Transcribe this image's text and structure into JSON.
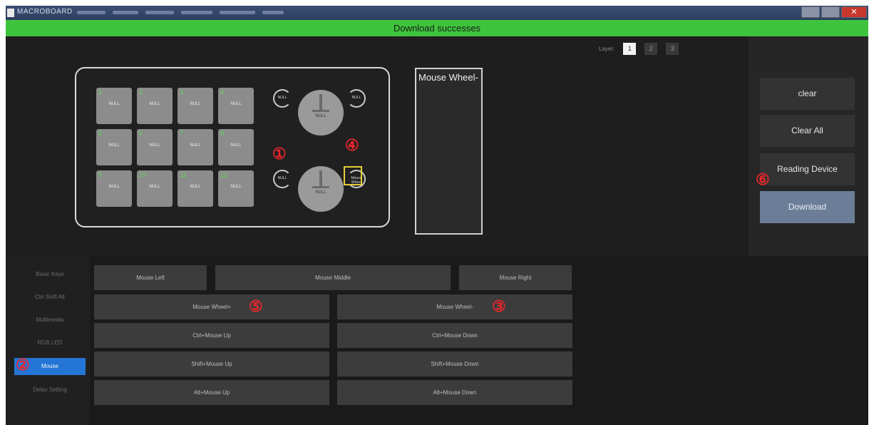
{
  "window": {
    "title": "MACROBOARD",
    "status": "Download successes"
  },
  "layer": {
    "label": "Layer:",
    "buttons": [
      "1",
      "2",
      "3"
    ],
    "active": "1"
  },
  "device": {
    "keys": [
      {
        "num": "1",
        "label": "NULL"
      },
      {
        "num": "2",
        "label": "NULL"
      },
      {
        "num": "3",
        "label": "NULL"
      },
      {
        "num": "4",
        "label": "NULL"
      },
      {
        "num": "5",
        "label": "NULL"
      },
      {
        "num": "6",
        "label": "NULL"
      },
      {
        "num": "7",
        "label": "NULL"
      },
      {
        "num": "8",
        "label": "NULL"
      },
      {
        "num": "9",
        "label": "NULL"
      },
      {
        "num": "10",
        "label": "NULL"
      },
      {
        "num": "11",
        "label": "NULL"
      },
      {
        "num": "12",
        "label": "NULL"
      }
    ],
    "knob1_label": "NULL",
    "knob2_label": "NULL",
    "rot1_left": "NULL",
    "rot1_right": "NULL",
    "rot2_left": "NULL",
    "rot2_right": "Mouse Wheel"
  },
  "callouts": [
    "①",
    "②",
    "③",
    "④",
    "⑤",
    "⑥"
  ],
  "preview": {
    "text": "Mouse Wheel-"
  },
  "right_panel": {
    "clear": "clear",
    "clear_all": "Clear All",
    "reading_device": "Reading Device",
    "download": "Download"
  },
  "nav": {
    "items": [
      "Basic Keys",
      "Ctrl Shift Alt",
      "Multimedia",
      "RGB LED",
      "Mouse",
      "Delay Setting"
    ],
    "active": "Mouse"
  },
  "mouse_buttons": {
    "left": "Mouse Left",
    "middle": "Mouse Middle",
    "right": "Mouse Right",
    "wheel_plus": "Mouse Wheel+",
    "wheel_minus": "Mouse Wheel-",
    "ctrl_up": "Ctrl+Mouse Up",
    "ctrl_down": "Ctrl+Mouse Down",
    "shift_up": "Shift+Mouse Up",
    "shift_down": "Shift+Mouse Down",
    "alt_up": "Alt+Mouse Up",
    "alt_down": "Alt+Mouse Down"
  },
  "colors": {
    "status_bar": "#3ec43c",
    "nav_active": "#2575d6",
    "callout": "#e8262a",
    "highlight": "#e5cf39",
    "download_button": "#6c7e97"
  }
}
